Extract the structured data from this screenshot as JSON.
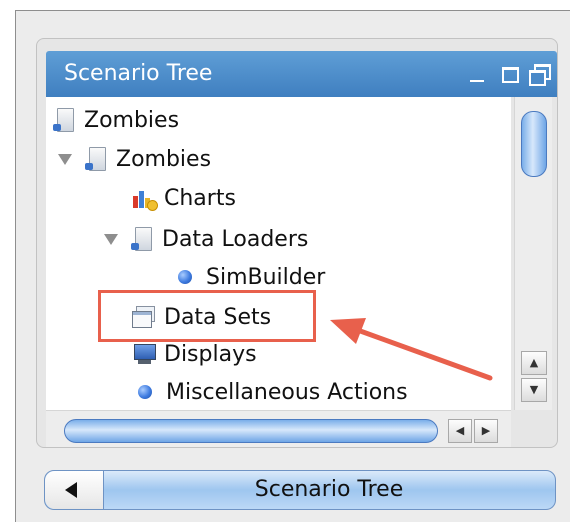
{
  "panel": {
    "title": "Scenario Tree"
  },
  "tree": {
    "items": [
      {
        "label": "Zombies",
        "icon": "document-icon"
      },
      {
        "label": "Zombies",
        "icon": "document-icon",
        "expanded": true
      },
      {
        "label": "Charts",
        "icon": "chart-icon"
      },
      {
        "label": "Data Loaders",
        "icon": "document-icon",
        "expanded": true
      },
      {
        "label": "SimBuilder",
        "icon": "blue-dot-icon"
      },
      {
        "label": "Data Sets",
        "icon": "data-sets-icon",
        "highlighted": true
      },
      {
        "label": "Displays",
        "icon": "monitor-icon"
      },
      {
        "label": "Miscellaneous Actions",
        "icon": "blue-dot-icon"
      }
    ]
  },
  "footer": {
    "label": "Scenario Tree"
  },
  "colors": {
    "titlebar": "#4f8fcf",
    "highlight": "#e8604c",
    "selection_blue": "#3e7be0"
  }
}
